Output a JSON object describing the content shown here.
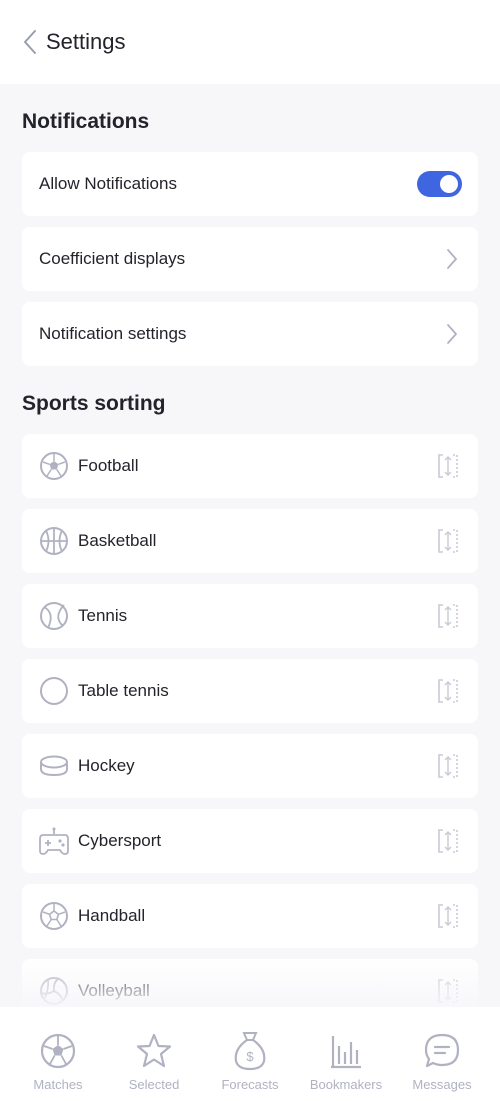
{
  "header": {
    "title": "Settings"
  },
  "notifications": {
    "title": "Notifications",
    "allow": {
      "label": "Allow Notifications",
      "enabled": true
    },
    "coefficient": {
      "label": "Coefficient displays"
    },
    "settings": {
      "label": "Notification settings"
    }
  },
  "sports": {
    "title": "Sports sorting",
    "items": [
      {
        "label": "Football",
        "icon": "football-icon"
      },
      {
        "label": "Basketball",
        "icon": "basketball-icon"
      },
      {
        "label": "Tennis",
        "icon": "tennis-icon"
      },
      {
        "label": "Table tennis",
        "icon": "table-tennis-icon"
      },
      {
        "label": "Hockey",
        "icon": "hockey-puck-icon"
      },
      {
        "label": "Cybersport",
        "icon": "gamepad-icon"
      },
      {
        "label": "Handball",
        "icon": "handball-icon"
      },
      {
        "label": "Volleyball",
        "icon": "volleyball-icon"
      }
    ]
  },
  "tabs": [
    {
      "label": "Matches",
      "icon": "ball-icon"
    },
    {
      "label": "Selected",
      "icon": "star-icon"
    },
    {
      "label": "Forecasts",
      "icon": "money-bag-icon"
    },
    {
      "label": "Bookmakers",
      "icon": "bar-chart-icon"
    },
    {
      "label": "Messages",
      "icon": "chat-icon"
    }
  ],
  "colors": {
    "accent": "#3f66e0",
    "icon": "#b0b2c2",
    "background": "#f7f7fa"
  }
}
